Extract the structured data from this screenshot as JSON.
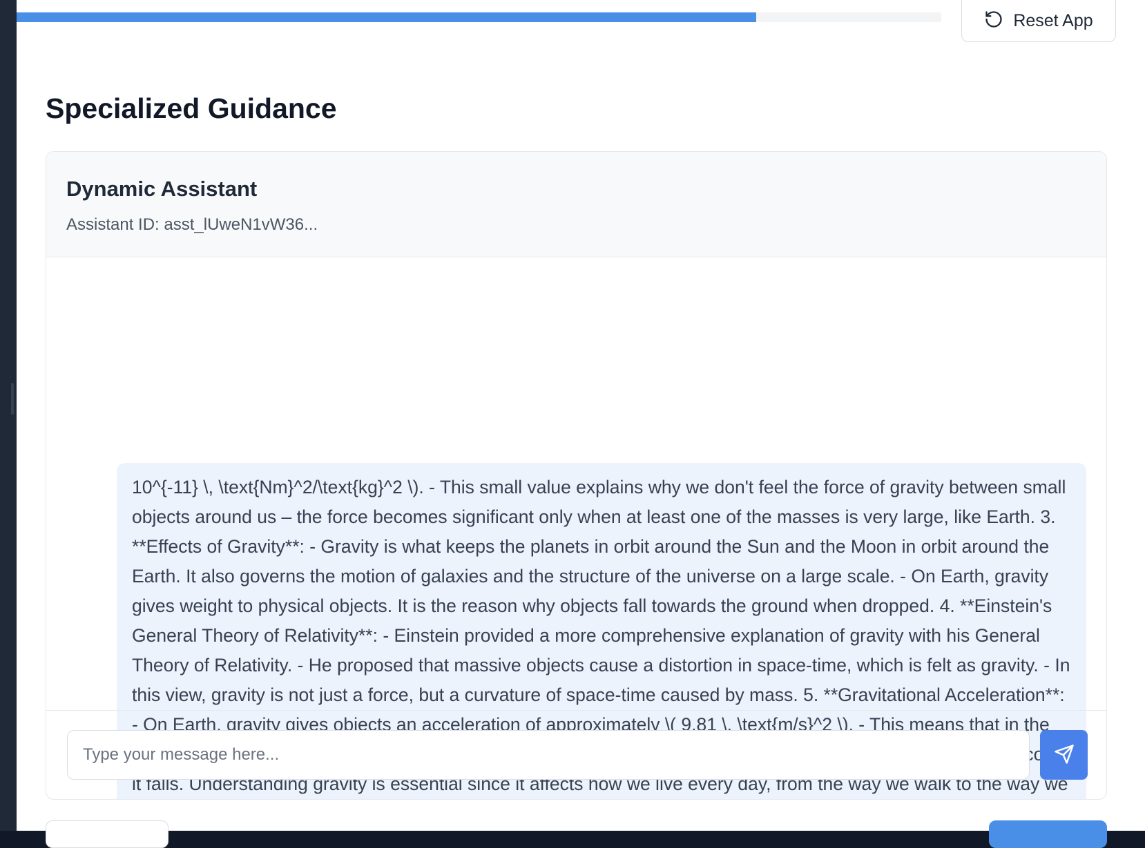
{
  "progress": {
    "percent": 80
  },
  "header": {
    "reset_label": "Reset App",
    "reset_icon": "refresh-ccw-icon"
  },
  "page": {
    "title": "Specialized Guidance"
  },
  "assistant": {
    "name": "Dynamic Assistant",
    "id_text": "Assistant ID: asst_lUweN1vW36..."
  },
  "messages": [
    {
      "role": "assistant",
      "text": "10^{-11} \\, \\text{Nm}^2/\\text{kg}^2 \\). - This small value explains why we don't feel the force of gravity between small objects around us – the force becomes significant only when at least one of the masses is very large, like Earth. 3. **Effects of Gravity**: - Gravity is what keeps the planets in orbit around the Sun and the Moon in orbit around the Earth. It also governs the motion of galaxies and the structure of the universe on a large scale. - On Earth, gravity gives weight to physical objects. It is the reason why objects fall towards the ground when dropped. 4. **Einstein's General Theory of Relativity**: - Einstein provided a more comprehensive explanation of gravity with his General Theory of Relativity. - He proposed that massive objects cause a distortion in space-time, which is felt as gravity. - In this view, gravity is not just a force, but a curvature of space-time caused by mass. 5. **Gravitational Acceleration**: - On Earth, gravity gives objects an acceleration of approximately \\( 9.81 \\, \\text{m/s}^2 \\). - This means that in the absence of other forces (like air resistance), an object's velocity increases by 9.81 meters per second every second it falls. Understanding gravity is essential since it affects how we live every day, from the way we walk to the way we launch satellites into space. If you have any more specific questions or need further clarification, feel free to ask!"
    }
  ],
  "composer": {
    "placeholder": "Type your message here...",
    "value": "",
    "send_icon": "send-icon"
  },
  "colors": {
    "accent": "#4a80ea",
    "progress": "#4a8fe7",
    "bubble_bg": "#edf3fd"
  }
}
